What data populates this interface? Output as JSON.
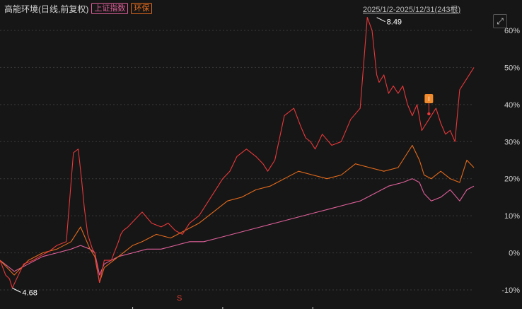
{
  "header": {
    "title": "高能环境(日线,前复权)",
    "badge1": "上证指数",
    "badge2": "环保",
    "range_label": "2025/1/2-2025/12/31(243根)",
    "expand_icon": "expand-icon"
  },
  "colors": {
    "main": "#e8383a",
    "index": "#e0609a",
    "sector": "#e46a1c",
    "neg_tick": "#2fbf4a",
    "grid": "#3a3a3a"
  },
  "markers": {
    "event_label": "I",
    "bottom_label": "S"
  },
  "chart_data": {
    "type": "line",
    "x_range": [
      "2025/1/2",
      "2025/12/31"
    ],
    "bar_count": 243,
    "ylim": [
      -10,
      65
    ],
    "yticks": [
      "60%",
      "50%",
      "40%",
      "30%",
      "20%",
      "10%",
      "0%",
      "-10%"
    ],
    "ytick_values": [
      60,
      50,
      40,
      30,
      20,
      10,
      0,
      -10
    ],
    "annotations": [
      {
        "text": "8.49",
        "x": 0.795,
        "y": 63.5
      },
      {
        "text": "4.68",
        "x": 0.026,
        "y": -9.5
      }
    ],
    "series": [
      {
        "x": [
          0.0,
          0.012,
          0.02,
          0.026,
          0.035,
          0.05,
          0.07,
          0.09,
          0.105,
          0.12,
          0.14,
          0.155,
          0.165,
          0.172,
          0.178,
          0.185,
          0.19,
          0.195,
          0.2,
          0.21,
          0.22,
          0.235,
          0.25,
          0.255,
          0.26,
          0.27,
          0.285,
          0.3,
          0.32,
          0.34,
          0.355,
          0.37,
          0.385,
          0.4,
          0.42,
          0.44,
          0.455,
          0.47,
          0.485,
          0.5,
          0.52,
          0.54,
          0.555,
          0.565,
          0.58,
          0.6,
          0.62,
          0.635,
          0.645,
          0.655,
          0.665,
          0.68,
          0.7,
          0.72,
          0.74,
          0.76,
          0.775,
          0.785,
          0.795,
          0.8,
          0.81,
          0.82,
          0.83,
          0.84,
          0.85,
          0.86,
          0.87,
          0.88,
          0.89,
          0.9,
          0.91,
          0.92,
          0.93,
          0.94,
          0.95,
          0.96,
          0.97,
          0.98,
          0.99,
          1.0
        ],
        "values": [
          -2,
          -6,
          -7,
          -9.5,
          -7,
          -3,
          -2,
          -0.5,
          0.5,
          2,
          3,
          27,
          28,
          20,
          12,
          5,
          3,
          1,
          0,
          -8,
          -2,
          -2,
          3,
          5,
          6,
          7,
          9,
          11,
          8,
          7,
          8,
          6,
          5,
          8,
          10,
          14,
          17,
          20,
          22,
          26,
          28,
          26,
          24,
          22,
          25,
          37,
          39,
          34,
          31,
          30,
          28,
          32,
          29,
          30,
          36,
          39,
          63.5,
          60,
          48,
          46,
          48,
          43,
          45,
          43,
          45,
          40,
          37,
          40,
          33,
          35,
          37,
          39,
          35,
          32,
          33,
          30,
          44,
          46,
          48,
          50
        ],
        "name": "",
        "color": "#e8383a"
      },
      {
        "x": [
          0.0,
          0.03,
          0.06,
          0.09,
          0.12,
          0.15,
          0.17,
          0.19,
          0.2,
          0.21,
          0.22,
          0.24,
          0.26,
          0.28,
          0.3,
          0.33,
          0.36,
          0.39,
          0.42,
          0.45,
          0.48,
          0.51,
          0.54,
          0.57,
          0.6,
          0.63,
          0.66,
          0.69,
          0.72,
          0.75,
          0.78,
          0.81,
          0.84,
          0.87,
          0.885,
          0.895,
          0.91,
          0.93,
          0.95,
          0.97,
          0.985,
          1.0
        ],
        "values": [
          -2,
          -6,
          -2,
          0,
          1,
          3,
          7,
          1,
          -1,
          -8,
          -4,
          -2,
          0,
          2,
          3,
          5,
          4,
          6,
          8,
          11,
          14,
          15,
          17,
          18,
          20,
          22,
          21,
          20,
          21,
          24,
          23,
          22,
          23,
          29,
          25,
          21,
          20,
          22,
          20,
          19,
          25,
          23
        ],
        "name": "",
        "color": "#e46a1c"
      },
      {
        "x": [
          0.0,
          0.03,
          0.06,
          0.09,
          0.12,
          0.15,
          0.17,
          0.19,
          0.2,
          0.21,
          0.22,
          0.25,
          0.28,
          0.31,
          0.34,
          0.37,
          0.4,
          0.43,
          0.46,
          0.49,
          0.52,
          0.55,
          0.58,
          0.61,
          0.64,
          0.67,
          0.7,
          0.73,
          0.76,
          0.79,
          0.82,
          0.85,
          0.87,
          0.885,
          0.895,
          0.91,
          0.93,
          0.95,
          0.97,
          0.985,
          1.0
        ],
        "values": [
          -2,
          -5,
          -3,
          -1,
          0,
          1,
          2,
          1,
          0,
          -6,
          -3,
          -1,
          0,
          1,
          1,
          2,
          3,
          3,
          4,
          5,
          6,
          7,
          8,
          9,
          10,
          11,
          12,
          13,
          14,
          16,
          18,
          19,
          20,
          19,
          16,
          14,
          15,
          17,
          14,
          17,
          18
        ],
        "name": "",
        "color": "#e0609a"
      }
    ]
  }
}
